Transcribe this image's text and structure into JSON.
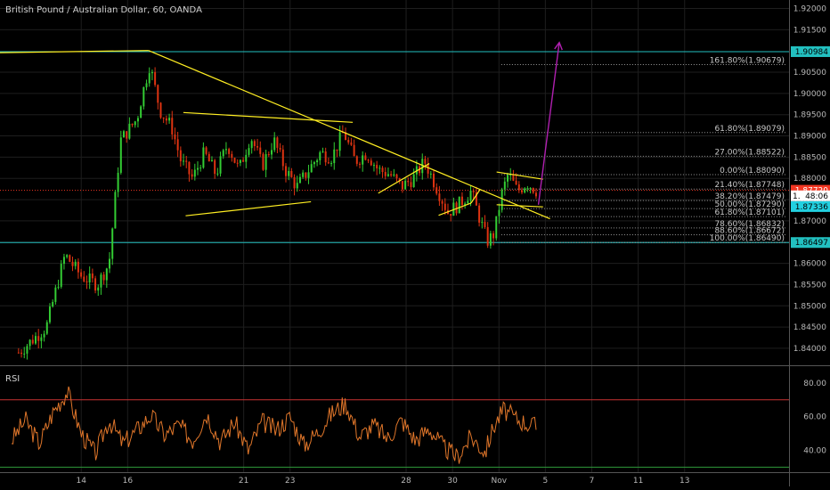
{
  "colors": {
    "background": "#000000",
    "grid": "#1e1e1e",
    "candle_up": "#33cc33",
    "candle_down": "#dd3311",
    "trendline": "#ffee22",
    "projection_arrow": "#b020b0",
    "fib_line": "#9a9a9a",
    "rsi_line": "#e0762a",
    "rsi_upper": "#c83232",
    "rsi_lower": "#2e9a3a",
    "cyan_line": "#22c0c0",
    "price_badge_red": "#f23622",
    "price_badge_cyan": "#22d0e0"
  },
  "chart_data": [
    {
      "type": "candlestick",
      "title": "British Pound / Australian Dollar, 60, OANDA",
      "ylim": [
        1.836,
        1.922
      ],
      "xlim": [
        10.5,
        14.9
      ],
      "x_ticks": [
        {
          "x": 14,
          "label": "14"
        },
        {
          "x": 16,
          "label": "16"
        },
        {
          "x": 21,
          "label": "21"
        },
        {
          "x": 23,
          "label": "23"
        },
        {
          "x": 28,
          "label": "28"
        },
        {
          "x": 30,
          "label": "30"
        },
        {
          "x": 32,
          "label": "Nov"
        },
        {
          "x": 34,
          "label": "5"
        },
        {
          "x": 36,
          "label": "7"
        },
        {
          "x": 38,
          "label": "11"
        },
        {
          "x": 40,
          "label": "13"
        }
      ],
      "y_ticks": [
        1.92,
        1.915,
        1.905,
        1.9,
        1.895,
        1.89,
        1.885,
        1.88,
        1.875,
        1.87,
        1.865,
        1.86,
        1.855,
        1.85,
        1.845,
        1.84
      ],
      "y_tick_labels": [
        "1.92000",
        "1.91500",
        "1.90500",
        "1.90000",
        "1.89500",
        "1.89000",
        "1.88500",
        "1.88000",
        "1.87500",
        "1.87000",
        "1.86500",
        "1.86000",
        "1.85500",
        "1.85000",
        "1.84500",
        "1.84000"
      ],
      "price_path": [
        [
          11.3,
          1.839
        ],
        [
          12.5,
          1.845
        ],
        [
          13.3,
          1.862
        ],
        [
          14.0,
          1.857
        ],
        [
          14.7,
          1.855
        ],
        [
          15.2,
          1.86
        ],
        [
          15.7,
          1.889
        ],
        [
          16.4,
          1.894
        ],
        [
          16.6,
          1.899
        ],
        [
          16.95,
          1.9068
        ],
        [
          17.4,
          1.896
        ],
        [
          17.9,
          1.892
        ],
        [
          18.3,
          1.884
        ],
        [
          18.8,
          1.88
        ],
        [
          19.3,
          1.886
        ],
        [
          19.8,
          1.881
        ],
        [
          20.3,
          1.888
        ],
        [
          20.8,
          1.882
        ],
        [
          21.3,
          1.89
        ],
        [
          21.8,
          1.883
        ],
        [
          22.3,
          1.889
        ],
        [
          22.8,
          1.882
        ],
        [
          23.3,
          1.878
        ],
        [
          23.8,
          1.882
        ],
        [
          24.3,
          1.886
        ],
        [
          24.8,
          1.885
        ],
        [
          25.3,
          1.891
        ],
        [
          25.8,
          1.884
        ],
        [
          26.3,
          1.886
        ],
        [
          26.8,
          1.882
        ],
        [
          27.3,
          1.881
        ],
        [
          27.8,
          1.878
        ],
        [
          28.3,
          1.88
        ],
        [
          28.8,
          1.884
        ],
        [
          29.3,
          1.878
        ],
        [
          29.8,
          1.872
        ],
        [
          30.3,
          1.874
        ],
        [
          30.8,
          1.877
        ],
        [
          31.2,
          1.87
        ],
        [
          31.5,
          1.8652
        ],
        [
          31.8,
          1.867
        ],
        [
          32.1,
          1.876
        ],
        [
          32.4,
          1.881
        ],
        [
          32.8,
          1.877
        ],
        [
          33.2,
          1.879
        ],
        [
          33.6,
          1.8772
        ]
      ],
      "trendlines": [
        {
          "x1": 10.5,
          "y1": 1.9096,
          "x2": 16.9,
          "y2": 1.9101
        },
        {
          "x1": 16.9,
          "y1": 1.9101,
          "x2": 34.2,
          "y2": 1.8705
        },
        {
          "x1": 18.5,
          "y1": 1.8712,
          "x2": 23.9,
          "y2": 1.8745
        },
        {
          "x1": 18.4,
          "y1": 1.8955,
          "x2": 25.7,
          "y2": 1.8932
        },
        {
          "x1": 26.8,
          "y1": 1.8765,
          "x2": 29.0,
          "y2": 1.8835
        },
        {
          "x1": 29.4,
          "y1": 1.8713,
          "x2": 30.8,
          "y2": 1.8742
        },
        {
          "x1": 30.8,
          "y1": 1.8742,
          "x2": 31.2,
          "y2": 1.8775
        },
        {
          "x1": 31.9,
          "y1": 1.8815,
          "x2": 33.9,
          "y2": 1.8798
        },
        {
          "x1": 31.9,
          "y1": 1.8738,
          "x2": 33.9,
          "y2": 1.8733
        }
      ],
      "projection_arrow": {
        "x1": 33.7,
        "y1": 1.8738,
        "x2": 34.6,
        "y2": 1.912
      },
      "fib_levels": [
        {
          "label": "161.80%(1.90679)",
          "value": 1.90679
        },
        {
          "label": "61.80%(1.89079)",
          "value": 1.89079
        },
        {
          "label": "27.00%(1.88522)",
          "value": 1.88522
        },
        {
          "label": "0.00%(1.88090)",
          "value": 1.8809
        },
        {
          "label": "21.40%(1.87748)",
          "value": 1.87748
        },
        {
          "label": "38.20%(1.87479)",
          "value": 1.87479
        },
        {
          "label": "50.00%(1.87290)",
          "value": 1.8729
        },
        {
          "label": "61.80%(1.87101)",
          "value": 1.87101
        },
        {
          "label": "78.60%(1.86832)",
          "value": 1.86832
        },
        {
          "label": "88.60%(1.86672)",
          "value": 1.86672
        },
        {
          "label": "100.00%(1.86490)",
          "value": 1.8649
        }
      ],
      "horizontal_lines": [
        {
          "value": 1.90984,
          "label": "1.90984",
          "style": "cyan"
        },
        {
          "value": 1.8772,
          "label": "1.87720",
          "style": "red-dotted"
        },
        {
          "value": 1.8649,
          "label": "1.86497",
          "style": "cyan"
        }
      ],
      "countdown_badge": {
        "value": 1.8759,
        "text": "1.",
        "time": "48:06"
      },
      "cyan_badge": {
        "value": 1.87336,
        "label": "1.87336"
      }
    },
    {
      "type": "line",
      "title": "RSI",
      "ylim": [
        27,
        90
      ],
      "y_ticks": [
        80,
        60,
        40
      ],
      "y_tick_labels": [
        "80.00",
        "60.00",
        "40.00"
      ],
      "upper_band": 70,
      "lower_band": 30,
      "rsi_path": [
        [
          11.0,
          46
        ],
        [
          11.6,
          58
        ],
        [
          12.2,
          44
        ],
        [
          12.8,
          63
        ],
        [
          13.4,
          75
        ],
        [
          14.0,
          50
        ],
        [
          14.6,
          38
        ],
        [
          15.2,
          58
        ],
        [
          15.8,
          44
        ],
        [
          16.4,
          52
        ],
        [
          17.0,
          61
        ],
        [
          17.6,
          49
        ],
        [
          18.2,
          55
        ],
        [
          18.8,
          46
        ],
        [
          19.4,
          62
        ],
        [
          20.0,
          45
        ],
        [
          20.6,
          57
        ],
        [
          21.2,
          40
        ],
        [
          21.8,
          57
        ],
        [
          22.4,
          52
        ],
        [
          23.0,
          60
        ],
        [
          23.6,
          43
        ],
        [
          24.2,
          51
        ],
        [
          24.8,
          62
        ],
        [
          25.4,
          68
        ],
        [
          26.0,
          48
        ],
        [
          26.6,
          55
        ],
        [
          27.2,
          47
        ],
        [
          27.8,
          58
        ],
        [
          28.4,
          46
        ],
        [
          29.0,
          53
        ],
        [
          29.6,
          42
        ],
        [
          30.2,
          36
        ],
        [
          30.8,
          48
        ],
        [
          31.4,
          39
        ],
        [
          31.8,
          55
        ],
        [
          32.2,
          64
        ],
        [
          32.7,
          59
        ],
        [
          33.2,
          56
        ],
        [
          33.6,
          54
        ]
      ]
    }
  ]
}
